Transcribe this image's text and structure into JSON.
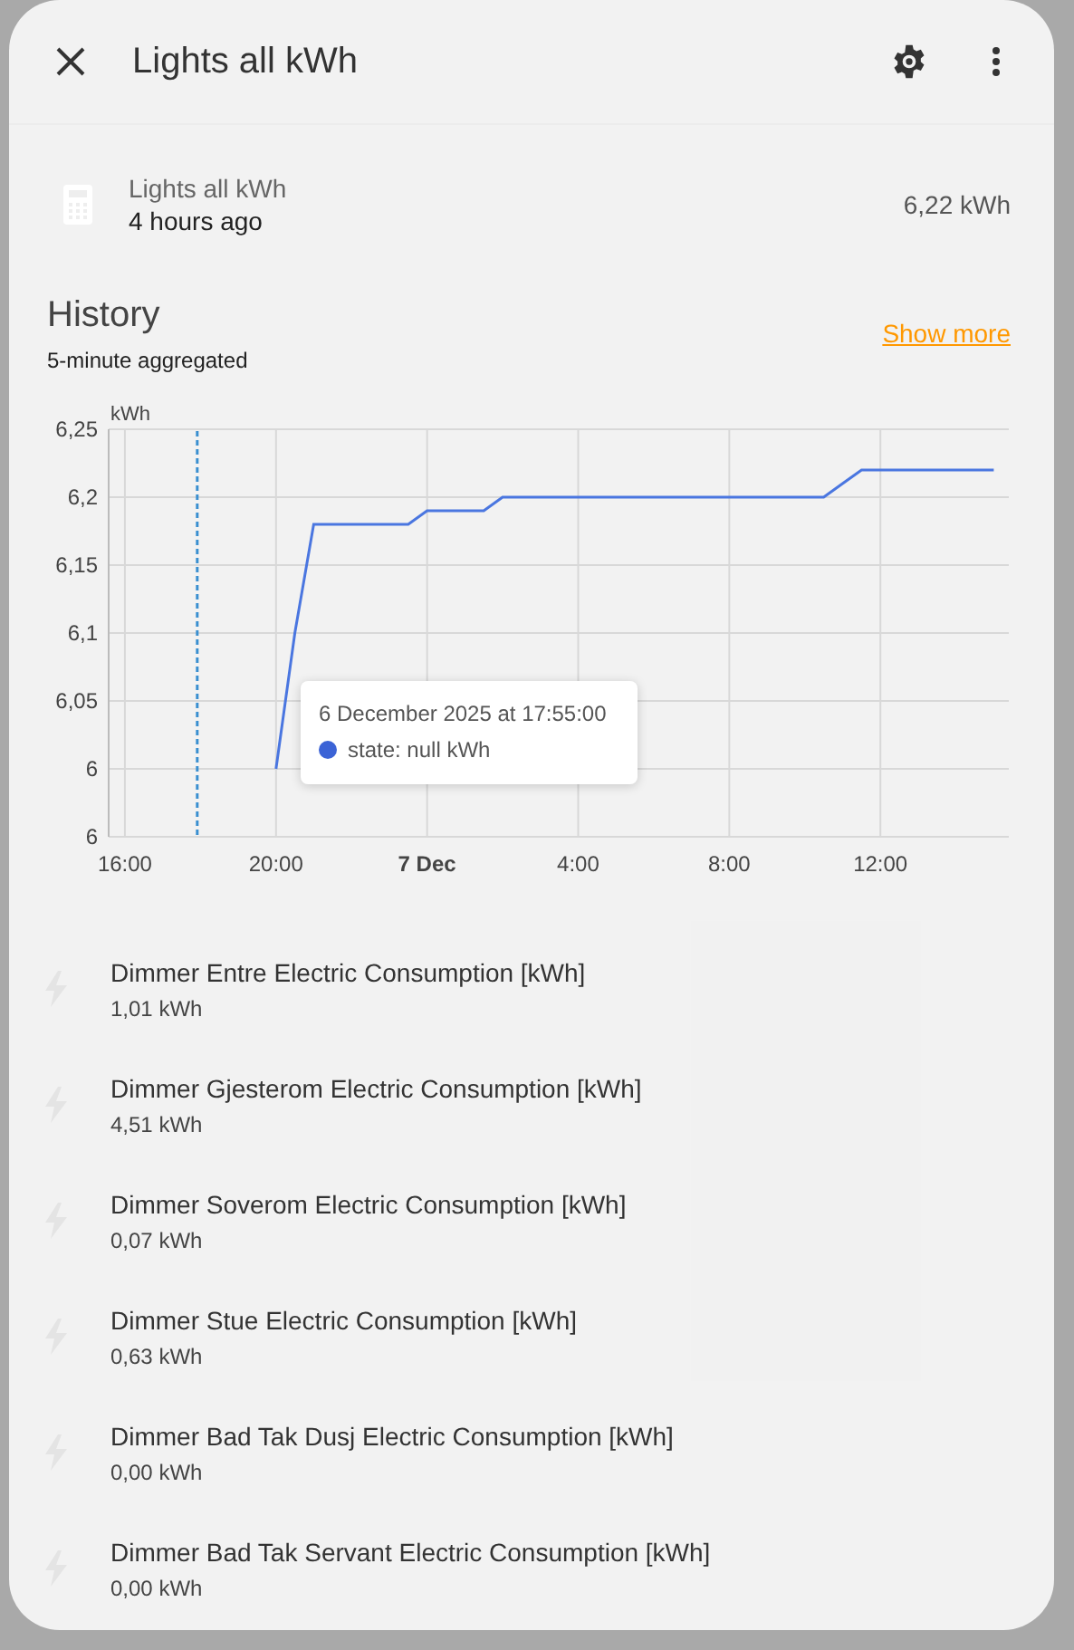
{
  "dialog": {
    "title": "Lights all kWh",
    "entity": {
      "name": "Lights all kWh",
      "time": "4 hours ago",
      "state": "6,22 kWh"
    },
    "history": {
      "title": "History",
      "subtitle": "5-minute aggregated",
      "link": "Show more",
      "cursor_line": true,
      "chart_data": {
        "type": "line",
        "ylabel": "kWh",
        "grid": true,
        "ylim": [
          5.95,
          6.25
        ],
        "categories": [
          "16:00",
          null,
          null,
          null,
          null,
          null,
          null,
          null,
          "20:00",
          null,
          null,
          null,
          null,
          null,
          null,
          null,
          "7 Dec",
          null,
          null,
          null,
          null,
          null,
          null,
          null,
          "4:00",
          null,
          null,
          null,
          null,
          null,
          null,
          null,
          "8:00",
          null,
          null,
          null,
          null,
          null,
          null,
          null,
          "12:00",
          null,
          null,
          null,
          null,
          null,
          null
        ],
        "yticks": [
          {
            "value": 5.95,
            "label": "6"
          },
          {
            "value": 6,
            "label": "6"
          },
          {
            "value": 6.05,
            "label": "6,05"
          },
          {
            "value": 6.1,
            "label": "6,1"
          },
          {
            "value": 6.15,
            "label": "6,15"
          },
          {
            "value": 6.2,
            "label": "6,2"
          },
          {
            "value": 6.25,
            "label": "6,25"
          }
        ],
        "series": [
          {
            "color": "#4a76e0",
            "values": [
              null,
              null,
              null,
              null,
              null,
              null,
              null,
              null,
              6.0,
              6.1,
              6.18,
              6.18,
              6.18,
              6.18,
              6.18,
              6.18,
              6.19,
              6.19,
              6.19,
              6.19,
              6.2,
              6.2,
              6.2,
              6.2,
              6.2,
              6.2,
              6.2,
              6.2,
              6.2,
              6.2,
              6.2,
              6.2,
              6.2,
              6.2,
              6.2,
              6.2,
              6.2,
              6.2,
              6.21,
              6.22,
              6.22,
              6.22,
              6.22,
              6.22,
              6.22,
              6.22,
              6.22
            ]
          }
        ]
      },
      "tooltip": {
        "title": "6 December 2025 at 17:55:00",
        "label": "state: null kWh",
        "color": "#3b63d6"
      }
    },
    "items": [
      {
        "name": "Dimmer Entre Electric Consumption [kWh]",
        "state": "1,01 kWh"
      },
      {
        "name": "Dimmer Gjesterom Electric Consumption [kWh]",
        "state": "4,51 kWh"
      },
      {
        "name": "Dimmer Soverom Electric Consumption [kWh]",
        "state": "0,07 kWh"
      },
      {
        "name": "Dimmer Stue Electric Consumption [kWh]",
        "state": "0,63 kWh"
      },
      {
        "name": "Dimmer Bad Tak Dusj Electric Consumption [kWh]",
        "state": "0,00 kWh"
      },
      {
        "name": "Dimmer Bad Tak Servant Electric Consumption [kWh]",
        "state": "0,00 kWh"
      }
    ]
  }
}
